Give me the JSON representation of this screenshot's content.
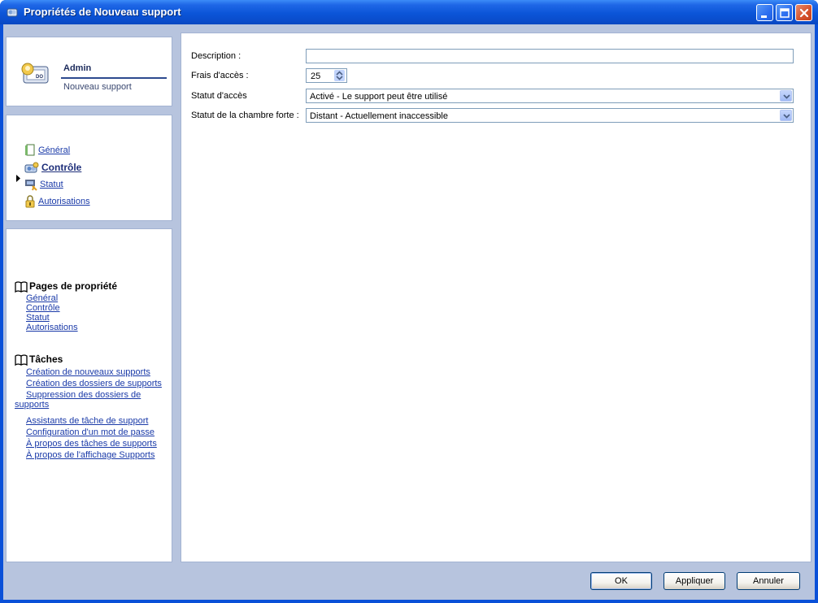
{
  "window": {
    "title": "Propriétés de Nouveau support",
    "icon": "properties-app-icon"
  },
  "user_panel": {
    "name": "Admin",
    "subtitle": "Nouveau support",
    "icon": "admin-user-icon"
  },
  "nav": {
    "items": [
      {
        "label": "Général",
        "icon": "document-icon"
      },
      {
        "label": "Contrôle",
        "icon": "control-media-icon",
        "active": true
      },
      {
        "label": "Statut",
        "icon": "status-icon"
      },
      {
        "label": "Autorisations",
        "icon": "lock-icon"
      }
    ]
  },
  "help": {
    "pages_title": "Pages de propriété",
    "pages": [
      "Général",
      "Contrôle",
      "Statut",
      "Autorisations"
    ],
    "tasks_title": "Tâches",
    "tasks": [
      "Création de nouveaux supports",
      "Création des dossiers de supports",
      "Suppression des dossiers de supports",
      "Assistants de tâche de support",
      "Configuration d'un mot de passe",
      "À propos des tâches de supports",
      "À propos de l'affichage Supports"
    ]
  },
  "form": {
    "description_label": "Description :",
    "description_value": "",
    "frais_label": "Frais d'accès :",
    "frais_value": "25",
    "statut_acces_label": "Statut d'accès",
    "statut_acces_value": "Activé - Le support peut être utilisé",
    "statut_chambre_label": "Statut de la chambre forte :",
    "statut_chambre_value": "Distant - Actuellement inaccessible"
  },
  "buttons": {
    "ok": "OK",
    "apply": "Appliquer",
    "cancel": "Annuler"
  },
  "colors": {
    "titlebar": "#0a4ccc",
    "client_bg": "#b7c4de",
    "link": "#1a3aa8"
  }
}
